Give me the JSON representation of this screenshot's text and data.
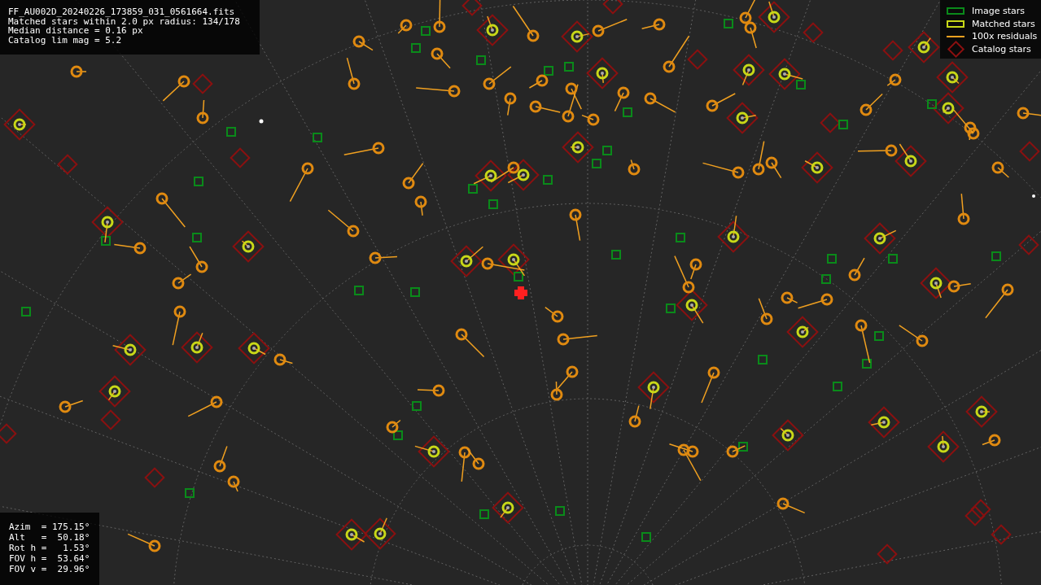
{
  "file_info": [
    "FF_AU002D_20240226_173859_031_0561664.fits",
    "Matched stars within 2.0 px radius: 134/178",
    "Median distance = 0.16 px",
    "Catalog lim mag = 5.2"
  ],
  "legend": [
    {
      "label": "Image stars",
      "kind": "image"
    },
    {
      "label": "Matched stars",
      "kind": "matched"
    },
    {
      "label": "100x residuals",
      "kind": "residual"
    },
    {
      "label": "Catalog stars",
      "kind": "catalog"
    }
  ],
  "pointing": [
    "Azim  = 175.15°",
    "Alt   =  50.18°",
    "Rot h =   1.53°",
    "FOV h =  53.64°",
    "FOV v =  29.96°"
  ]
}
